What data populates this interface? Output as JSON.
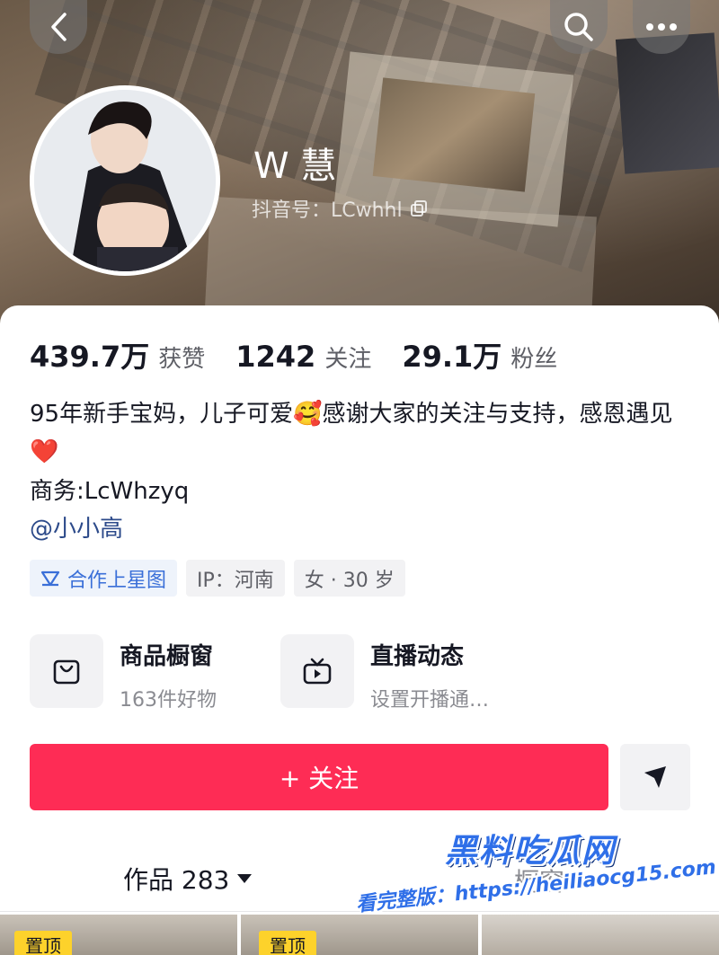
{
  "header": {
    "nickname": "W 慧",
    "douyin_id": "抖音号：LCwhhl"
  },
  "stats": [
    {
      "value": "439.7万",
      "label": "获赞"
    },
    {
      "value": "1242",
      "label": "关注"
    },
    {
      "value": "29.1万",
      "label": "粉丝"
    }
  ],
  "bio": {
    "line": "95年新手宝妈，儿子可爱🥰感谢大家的关注与支持，感恩遇见❤️",
    "business": "商务:LcWhzyq",
    "mention": "@小小高"
  },
  "tags": [
    {
      "label": "合作上星图",
      "icon": "star-map-icon"
    },
    {
      "label": "IP：河南"
    },
    {
      "label": "女 · 30 岁"
    }
  ],
  "features": [
    {
      "title": "商品橱窗",
      "subtitle": "163件好物",
      "icon": "shopping-bag-icon"
    },
    {
      "title": "直播动态",
      "subtitle": "设置开播通…",
      "icon": "tv-icon"
    }
  ],
  "actions": {
    "follow_label": "+ 关注"
  },
  "tabs": {
    "works_label": "作品 283",
    "window_label": "橱窗"
  },
  "thumbnails": {
    "pin_label": "置顶"
  },
  "watermark": {
    "title": "黑料吃瓜网",
    "url": "看完整版：https://heiliaocg15.com"
  },
  "colors": {
    "accent": "#fe2c55",
    "link": "#2c4a8a",
    "pin": "#fdd22b"
  }
}
